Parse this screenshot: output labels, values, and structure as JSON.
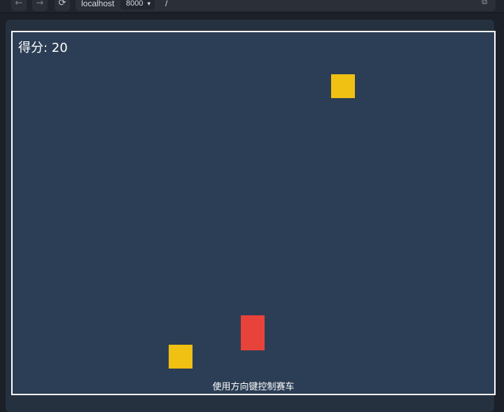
{
  "browser": {
    "host": "localhost",
    "port": "8000",
    "path": "/"
  },
  "game": {
    "score_label": "得分: 20",
    "instructions": "使用方向键控制赛车",
    "colors": {
      "canvas_background": "#2c3e55",
      "border": "#ffffff",
      "player": "#e8433a",
      "obstacle": "#f0c013"
    }
  }
}
